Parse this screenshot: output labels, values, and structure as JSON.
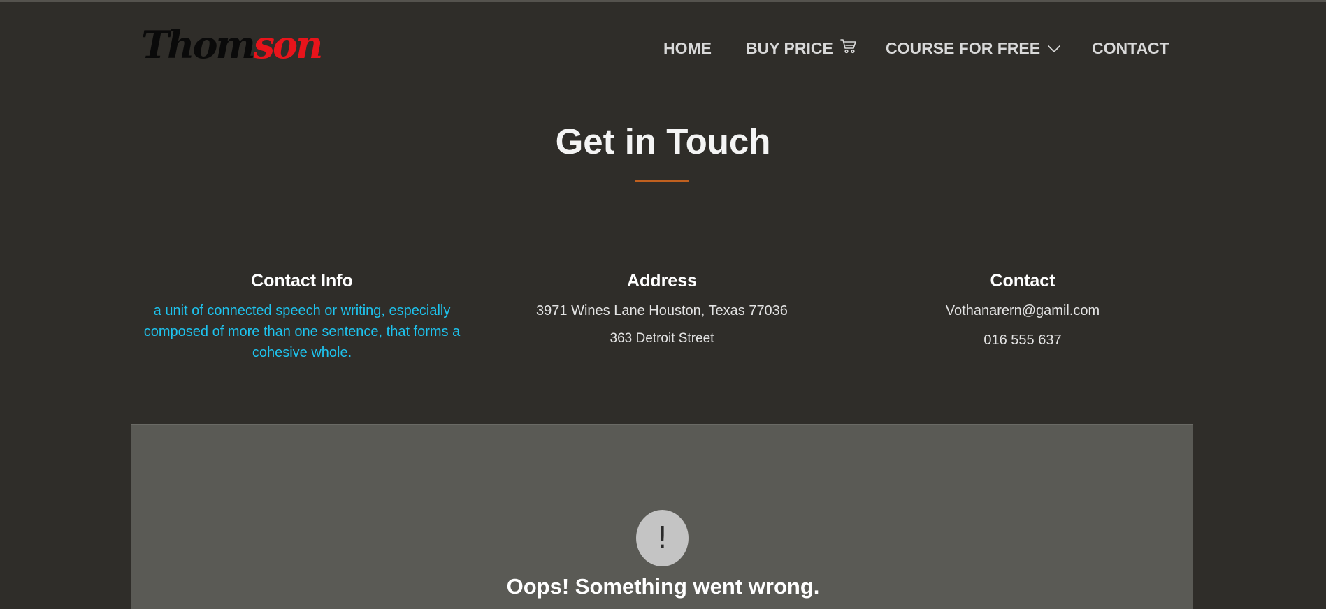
{
  "header": {
    "logo": {
      "part_a": "Thom",
      "part_b": "son"
    },
    "nav": [
      {
        "label": "HOME",
        "icon": null
      },
      {
        "label": "BUY PRICE",
        "icon": "cart-icon"
      },
      {
        "label": "COURSE FOR FREE",
        "icon": "chevron-down-icon"
      },
      {
        "label": "CONTACT",
        "icon": null
      }
    ]
  },
  "section": {
    "title": "Get in Touch",
    "accent_color": "#c0601f"
  },
  "columns": {
    "contact_info": {
      "heading": "Contact Info",
      "text_lines": [
        "a unit of connected speech or writing, especially",
        "composed of more than one sentence, that forms a",
        "cohesive whole."
      ],
      "text_color": "#1ec3ee"
    },
    "address": {
      "heading": "Address",
      "line1": "3971 Wines Lane Houston, Texas 77036",
      "line2": "363 Detroit Street"
    },
    "contact": {
      "heading": "Contact",
      "email": "Vothanarern@gamil.com",
      "phone": "016 555 637"
    }
  },
  "map_error": {
    "icon": "exclamation-icon",
    "symbol": "!",
    "message": "Oops! Something went wrong."
  }
}
